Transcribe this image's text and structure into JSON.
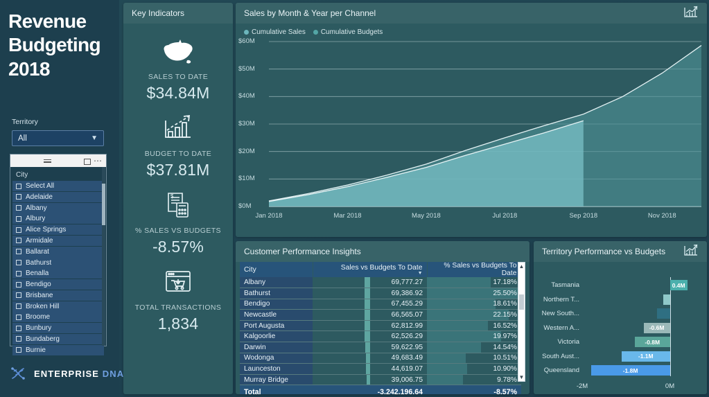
{
  "sidebar": {
    "title_lines": [
      "Revenue",
      "Budgeting",
      "2018"
    ],
    "territory": {
      "label": "Territory",
      "value": "All",
      "chevron": "chevron-down-icon"
    },
    "city_slicer": {
      "title": "City",
      "toolbar": [
        "filter-icon",
        "focus-mode-icon",
        "more-options-icon"
      ],
      "items": [
        "Select All",
        "Adelaide",
        "Albany",
        "Albury",
        "Alice Springs",
        "Armidale",
        "Ballarat",
        "Bathurst",
        "Benalla",
        "Bendigo",
        "Brisbane",
        "Broken Hill",
        "Broome",
        "Bunbury",
        "Bundaberg",
        "Burnie"
      ]
    },
    "logo": {
      "word1": "ENTERPRISE",
      "word2": "DNA",
      "icon": "dna-helix-icon"
    }
  },
  "kpi_panel": {
    "title": "Key Indicators",
    "cards": [
      {
        "icon": "australia-map-icon",
        "label": "SALES TO DATE",
        "value": "$34.84M"
      },
      {
        "icon": "growth-chart-icon",
        "label": "BUDGET TO DATE",
        "value": "$37.81M"
      },
      {
        "icon": "invoice-calculator-icon",
        "label": "% SALES VS BUDGETS",
        "value": "-8.57%"
      },
      {
        "icon": "online-cart-icon",
        "label": "TOTAL TRANSACTIONS",
        "value": "1,834"
      }
    ]
  },
  "area_card": {
    "title": "Sales by Month & Year per Channel",
    "head_icon": "bar-chart-icon"
  },
  "table_card": {
    "title": "Customer Performance Insights",
    "columns": [
      "City",
      "Sales vs Budgets To Date",
      "% Sales vs Budgets To Date"
    ],
    "sort_column_index": 1,
    "rows": [
      {
        "city": "Albany",
        "sales": "69,777.27",
        "pct": "17.18%",
        "sales_num": 69777.27,
        "pct_num": 17.18
      },
      {
        "city": "Bathurst",
        "sales": "69,386.92",
        "pct": "25.50%",
        "sales_num": 69386.92,
        "pct_num": 25.5
      },
      {
        "city": "Bendigo",
        "sales": "67,455.29",
        "pct": "18.61%",
        "sales_num": 67455.29,
        "pct_num": 18.61
      },
      {
        "city": "Newcastle",
        "sales": "66,565.07",
        "pct": "22.15%",
        "sales_num": 66565.07,
        "pct_num": 22.15
      },
      {
        "city": "Port Augusta",
        "sales": "62,812.99",
        "pct": "16.52%",
        "sales_num": 62812.99,
        "pct_num": 16.52
      },
      {
        "city": "Kalgoorlie",
        "sales": "62,526.29",
        "pct": "19.97%",
        "sales_num": 62526.29,
        "pct_num": 19.97
      },
      {
        "city": "Darwin",
        "sales": "59,622.95",
        "pct": "14.54%",
        "sales_num": 59622.95,
        "pct_num": 14.54
      },
      {
        "city": "Wodonga",
        "sales": "49,683.49",
        "pct": "10.51%",
        "sales_num": 49683.49,
        "pct_num": 10.51
      },
      {
        "city": "Launceston",
        "sales": "44,619.07",
        "pct": "10.90%",
        "sales_num": 44619.07,
        "pct_num": 10.9
      },
      {
        "city": "Murray Bridge",
        "sales": "39,006.75",
        "pct": "9.78%",
        "sales_num": 39006.75,
        "pct_num": 9.78
      }
    ],
    "total": {
      "label": "Total",
      "sales": "-3,242,196.64",
      "pct": "-8.57%"
    },
    "scrollbar": {
      "up": "scroll-up-arrow",
      "down": "scroll-down-arrow"
    }
  },
  "territory_card": {
    "title": "Territory Performance vs Budgets",
    "head_icon": "bar-chart-icon"
  },
  "colors": {
    "page_bg": "#1e4250",
    "sidebar_bg": "#1d3f4e",
    "card_bg": "#2d5a60",
    "accent_teal": "#68b4ad",
    "accent_blue": "#4a9ae8",
    "header_blue": "#27547a",
    "text_light": "#eaf4f7"
  },
  "chart_data": [
    {
      "type": "area",
      "title": "Sales by Month & Year per Channel",
      "xlabel": "",
      "ylabel": "",
      "grid": true,
      "legend_position": "top-left",
      "legend": [
        "Cumulative Sales",
        "Cumulative Budgets"
      ],
      "x": [
        "Jan 2018",
        "Feb 2018",
        "Mar 2018",
        "Apr 2018",
        "May 2018",
        "Jun 2018",
        "Jul 2018",
        "Aug 2018",
        "Sep 2018",
        "Oct 2018",
        "Nov 2018",
        "Dec 2018"
      ],
      "xticks": [
        "Jan 2018",
        "Mar 2018",
        "May 2018",
        "Jul 2018",
        "Sep 2018",
        "Nov 2018"
      ],
      "yticks": [
        "$0M",
        "$10M",
        "$20M",
        "$30M",
        "$40M",
        "$50M",
        "$60M"
      ],
      "ylim": [
        0,
        60
      ],
      "series": [
        {
          "name": "Cumulative Sales",
          "color": "#6cb6bc",
          "values": [
            1.8,
            4.3,
            7.2,
            10.6,
            14.2,
            18.6,
            22.7,
            26.8,
            31.2,
            null,
            null,
            null
          ]
        },
        {
          "name": "Cumulative Budgets",
          "color": "#4e8f96",
          "values": [
            2.0,
            4.7,
            7.8,
            11.4,
            15.4,
            20.4,
            25.0,
            29.4,
            33.6,
            40.0,
            48.5,
            58.6
          ]
        }
      ]
    },
    {
      "type": "bar",
      "orientation": "horizontal",
      "title": "Territory Performance vs Budgets",
      "categories": [
        "Tasmania",
        "Northern T...",
        "New South...",
        "Western A...",
        "Victoria",
        "South Aust...",
        "Queensland"
      ],
      "values": [
        0.4,
        -0.15,
        -0.3,
        -0.6,
        -0.8,
        -1.1,
        -1.8
      ],
      "labels": [
        "0.4M",
        "",
        "",
        "-0.6M",
        "-0.8M",
        "-1.1M",
        "-1.8M"
      ],
      "colors": [
        "#4bb0ad",
        "#8fc9c9",
        "#2f6f82",
        "#9ab8b8",
        "#5aa69a",
        "#69b8ea",
        "#4a9ae8"
      ],
      "xticks": [
        "-2M",
        "0M"
      ],
      "xlim": [
        -2.0,
        0.75
      ],
      "grid": false
    }
  ]
}
